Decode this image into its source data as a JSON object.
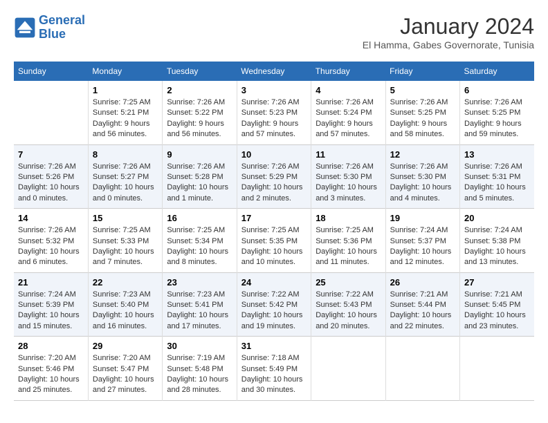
{
  "logo": {
    "line1": "General",
    "line2": "Blue"
  },
  "title": "January 2024",
  "subtitle": "El Hamma, Gabes Governorate, Tunisia",
  "weekdays": [
    "Sunday",
    "Monday",
    "Tuesday",
    "Wednesday",
    "Thursday",
    "Friday",
    "Saturday"
  ],
  "weeks": [
    [
      {
        "day": "",
        "text": ""
      },
      {
        "day": "1",
        "text": "Sunrise: 7:25 AM\nSunset: 5:21 PM\nDaylight: 9 hours\nand 56 minutes."
      },
      {
        "day": "2",
        "text": "Sunrise: 7:26 AM\nSunset: 5:22 PM\nDaylight: 9 hours\nand 56 minutes."
      },
      {
        "day": "3",
        "text": "Sunrise: 7:26 AM\nSunset: 5:23 PM\nDaylight: 9 hours\nand 57 minutes."
      },
      {
        "day": "4",
        "text": "Sunrise: 7:26 AM\nSunset: 5:24 PM\nDaylight: 9 hours\nand 57 minutes."
      },
      {
        "day": "5",
        "text": "Sunrise: 7:26 AM\nSunset: 5:25 PM\nDaylight: 9 hours\nand 58 minutes."
      },
      {
        "day": "6",
        "text": "Sunrise: 7:26 AM\nSunset: 5:25 PM\nDaylight: 9 hours\nand 59 minutes."
      }
    ],
    [
      {
        "day": "7",
        "text": "Sunrise: 7:26 AM\nSunset: 5:26 PM\nDaylight: 10 hours\nand 0 minutes."
      },
      {
        "day": "8",
        "text": "Sunrise: 7:26 AM\nSunset: 5:27 PM\nDaylight: 10 hours\nand 0 minutes."
      },
      {
        "day": "9",
        "text": "Sunrise: 7:26 AM\nSunset: 5:28 PM\nDaylight: 10 hours\nand 1 minute."
      },
      {
        "day": "10",
        "text": "Sunrise: 7:26 AM\nSunset: 5:29 PM\nDaylight: 10 hours\nand 2 minutes."
      },
      {
        "day": "11",
        "text": "Sunrise: 7:26 AM\nSunset: 5:30 PM\nDaylight: 10 hours\nand 3 minutes."
      },
      {
        "day": "12",
        "text": "Sunrise: 7:26 AM\nSunset: 5:30 PM\nDaylight: 10 hours\nand 4 minutes."
      },
      {
        "day": "13",
        "text": "Sunrise: 7:26 AM\nSunset: 5:31 PM\nDaylight: 10 hours\nand 5 minutes."
      }
    ],
    [
      {
        "day": "14",
        "text": "Sunrise: 7:26 AM\nSunset: 5:32 PM\nDaylight: 10 hours\nand 6 minutes."
      },
      {
        "day": "15",
        "text": "Sunrise: 7:25 AM\nSunset: 5:33 PM\nDaylight: 10 hours\nand 7 minutes."
      },
      {
        "day": "16",
        "text": "Sunrise: 7:25 AM\nSunset: 5:34 PM\nDaylight: 10 hours\nand 8 minutes."
      },
      {
        "day": "17",
        "text": "Sunrise: 7:25 AM\nSunset: 5:35 PM\nDaylight: 10 hours\nand 10 minutes."
      },
      {
        "day": "18",
        "text": "Sunrise: 7:25 AM\nSunset: 5:36 PM\nDaylight: 10 hours\nand 11 minutes."
      },
      {
        "day": "19",
        "text": "Sunrise: 7:24 AM\nSunset: 5:37 PM\nDaylight: 10 hours\nand 12 minutes."
      },
      {
        "day": "20",
        "text": "Sunrise: 7:24 AM\nSunset: 5:38 PM\nDaylight: 10 hours\nand 13 minutes."
      }
    ],
    [
      {
        "day": "21",
        "text": "Sunrise: 7:24 AM\nSunset: 5:39 PM\nDaylight: 10 hours\nand 15 minutes."
      },
      {
        "day": "22",
        "text": "Sunrise: 7:23 AM\nSunset: 5:40 PM\nDaylight: 10 hours\nand 16 minutes."
      },
      {
        "day": "23",
        "text": "Sunrise: 7:23 AM\nSunset: 5:41 PM\nDaylight: 10 hours\nand 17 minutes."
      },
      {
        "day": "24",
        "text": "Sunrise: 7:22 AM\nSunset: 5:42 PM\nDaylight: 10 hours\nand 19 minutes."
      },
      {
        "day": "25",
        "text": "Sunrise: 7:22 AM\nSunset: 5:43 PM\nDaylight: 10 hours\nand 20 minutes."
      },
      {
        "day": "26",
        "text": "Sunrise: 7:21 AM\nSunset: 5:44 PM\nDaylight: 10 hours\nand 22 minutes."
      },
      {
        "day": "27",
        "text": "Sunrise: 7:21 AM\nSunset: 5:45 PM\nDaylight: 10 hours\nand 23 minutes."
      }
    ],
    [
      {
        "day": "28",
        "text": "Sunrise: 7:20 AM\nSunset: 5:46 PM\nDaylight: 10 hours\nand 25 minutes."
      },
      {
        "day": "29",
        "text": "Sunrise: 7:20 AM\nSunset: 5:47 PM\nDaylight: 10 hours\nand 27 minutes."
      },
      {
        "day": "30",
        "text": "Sunrise: 7:19 AM\nSunset: 5:48 PM\nDaylight: 10 hours\nand 28 minutes."
      },
      {
        "day": "31",
        "text": "Sunrise: 7:18 AM\nSunset: 5:49 PM\nDaylight: 10 hours\nand 30 minutes."
      },
      {
        "day": "",
        "text": ""
      },
      {
        "day": "",
        "text": ""
      },
      {
        "day": "",
        "text": ""
      }
    ]
  ]
}
